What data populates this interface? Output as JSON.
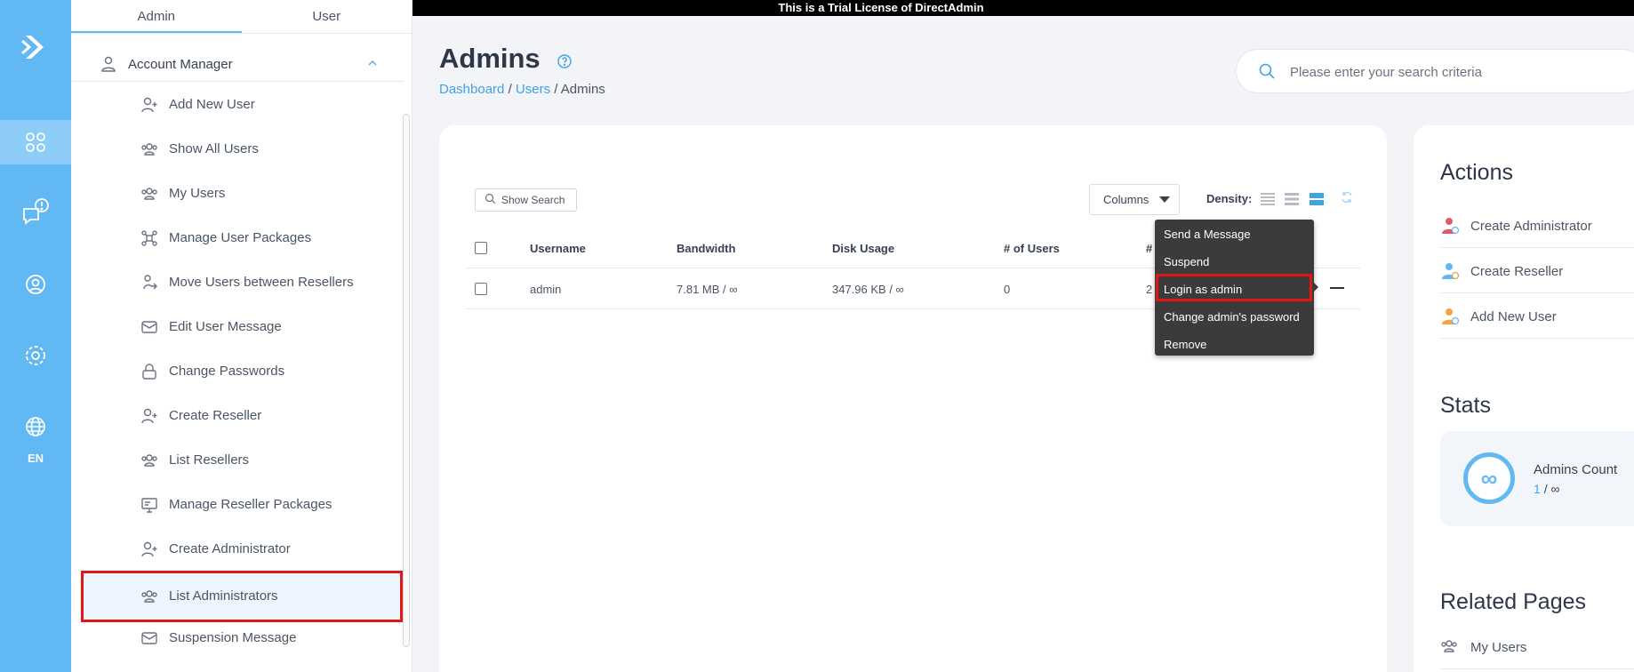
{
  "trial_banner": "This is a Trial License of DirectAdmin",
  "rail": {
    "lang": "EN"
  },
  "sidebar": {
    "tabs": [
      "Admin",
      "User"
    ],
    "section_title": "Account Manager",
    "items": [
      {
        "label": "Add New User",
        "icon": "add-user-icon"
      },
      {
        "label": "Show All Users",
        "icon": "users-icon"
      },
      {
        "label": "My Users",
        "icon": "users-icon"
      },
      {
        "label": "Manage User Packages",
        "icon": "packages-icon"
      },
      {
        "label": "Move Users between Resellers",
        "icon": "move-users-icon"
      },
      {
        "label": "Edit User Message",
        "icon": "envelope-icon"
      },
      {
        "label": "Change Passwords",
        "icon": "lock-icon"
      },
      {
        "label": "Create Reseller",
        "icon": "add-user-icon"
      },
      {
        "label": "List Resellers",
        "icon": "users-icon"
      },
      {
        "label": "Manage Reseller Packages",
        "icon": "monitor-icon"
      },
      {
        "label": "Create Administrator",
        "icon": "add-user-icon"
      },
      {
        "label": "List Administrators",
        "icon": "users-icon"
      },
      {
        "label": "Suspension Message",
        "icon": "envelope-icon"
      }
    ],
    "selected_item": "List Administrators"
  },
  "header": {
    "title": "Admins",
    "breadcrumb": [
      "Dashboard",
      "Users",
      "Admins"
    ],
    "search_placeholder": "Please enter your search criteria"
  },
  "toolbar": {
    "show_search": "Show Search",
    "columns": "Columns",
    "density_label": "Density:"
  },
  "table": {
    "columns": [
      "Username",
      "Bandwidth",
      "Disk Usage",
      "# of Users",
      "#"
    ],
    "rows": [
      {
        "username": "admin",
        "bandwidth": "7.81 MB / ∞",
        "disk_usage": "347.96 KB / ∞",
        "users": "0",
        "hidden_col": "2"
      }
    ]
  },
  "row_menu": {
    "items": [
      "Send a Message",
      "Suspend",
      "Login as admin",
      "Change admin's password",
      "Remove"
    ],
    "highlighted": "Login as admin"
  },
  "actions": {
    "title": "Actions",
    "items": [
      "Create Administrator",
      "Create Reseller",
      "Add New User"
    ]
  },
  "stats": {
    "title": "Stats",
    "label": "Admins Count",
    "count": "1",
    "sep": "/",
    "limit": "∞",
    "circle_symbol": "∞"
  },
  "related": {
    "title": "Related Pages",
    "items": [
      "My Users"
    ]
  },
  "colors": {
    "accent": "#62b8f2",
    "link": "#3fa3e8",
    "highlight": "#e01717"
  }
}
